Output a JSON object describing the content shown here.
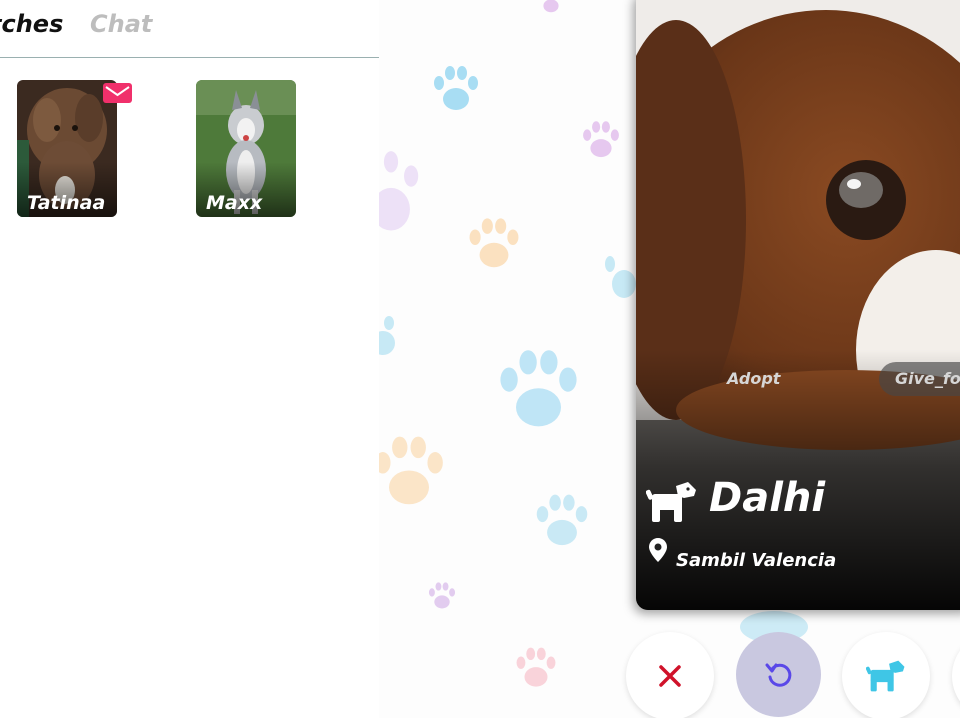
{
  "tabs": {
    "matches": "tches",
    "chat": "Chat"
  },
  "matches": [
    {
      "name": "Tatinaa",
      "unread": true
    },
    {
      "name": "Maxx",
      "unread": false
    }
  ],
  "card": {
    "name": "Dalhi",
    "location": "Sambil Valencia",
    "tags": [
      "Adopt",
      "Give_for"
    ]
  },
  "actions": {
    "reject_icon": "close-icon",
    "undo_icon": "undo-icon",
    "like_icon": "dog-icon"
  },
  "colors": {
    "mail_badge": "#f0306b",
    "reject": "#d0122a",
    "undo": "#5a48e8",
    "like": "#3fc6e6"
  }
}
